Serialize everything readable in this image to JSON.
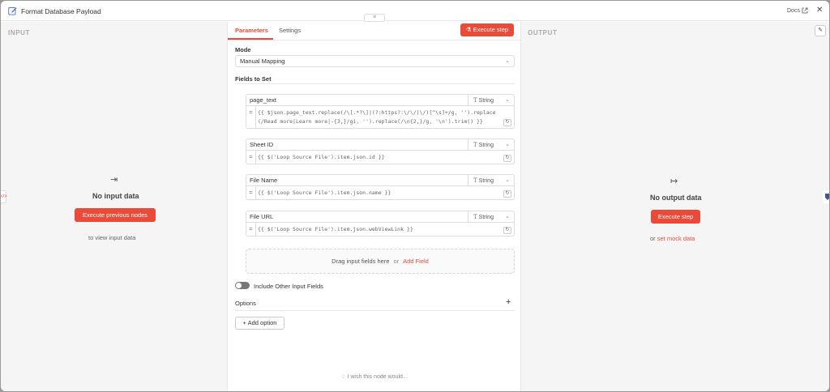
{
  "window": {
    "title": "Format Database Payload",
    "docs_label": "Docs",
    "handle_glyph": "≡",
    "close_glyph": "✕"
  },
  "input_panel": {
    "label": "INPUT",
    "icon_glyph": "⇥",
    "empty_title": "No input data",
    "button_label": "Execute previous nodes",
    "hint": "to view input data"
  },
  "output_panel": {
    "label": "OUTPUT",
    "icon_glyph": "↦",
    "empty_title": "No output data",
    "button_label": "Execute step",
    "hint_prefix": "or",
    "hint_link": "set mock data",
    "pencil_glyph": "✎"
  },
  "edge_tab_left": "</>",
  "tabs": [
    {
      "label": "Parameters",
      "active": true
    },
    {
      "label": "Settings",
      "active": false
    }
  ],
  "execute_step_label": "Execute step",
  "mode": {
    "label": "Mode",
    "value": "Manual Mapping"
  },
  "fields_to_set": {
    "label": "Fields to Set",
    "fields": [
      {
        "name": "page_text",
        "type": "String",
        "value": "{{ $json.page_text.replace(/\\[.*?\\]|(?:https?:\\/\\/|\\/)[^\\s]+/g, '').replace(/Read more|Learn more|-{3,}/gi, '').replace(/\\n{2,}/g, '\\n').trim() }}"
      },
      {
        "name": "Sheet ID",
        "type": "String",
        "value": "{{ $('Loop Source File').item.json.id }}"
      },
      {
        "name": "File Name",
        "type": "String",
        "value": "{{ $('Loop Source File').item.json.name }}"
      },
      {
        "name": "File URL",
        "type": "String",
        "value": "{{ $('Loop Source File').item.json.webViewLink }}"
      }
    ]
  },
  "dropzone": {
    "text": "Drag input fields here",
    "or": "or",
    "link": "Add Field"
  },
  "include_other": {
    "label": "Include Other Input Fields",
    "enabled": false
  },
  "options": {
    "label": "Options",
    "add_label": "Add option",
    "plus_glyph": "+"
  },
  "footer_hint": "I wish this node would...",
  "colors": {
    "accent": "#ea4b39",
    "panel_bg": "#f5f5f5"
  }
}
